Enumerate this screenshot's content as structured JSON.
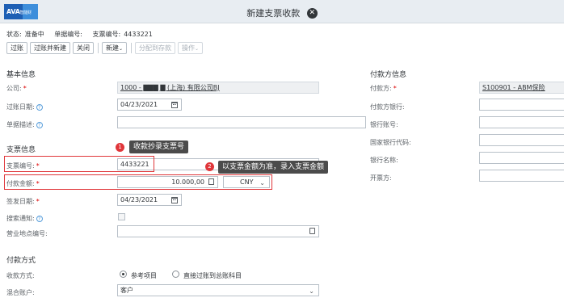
{
  "header": {
    "logo_text": "AVA",
    "logo_sub": "智能财",
    "title": "新建支票收款"
  },
  "status": {
    "status_label": "状态:",
    "status_value": "准备中",
    "doc_no_label": "单据编号:",
    "cheque_no_label": "支票编号:",
    "cheque_no_value": "4433221"
  },
  "toolbar": {
    "post": "过账",
    "post_new": "过账并新建",
    "close": "关闭",
    "new": "新建",
    "allocate": "分配到存款",
    "actions": "操作"
  },
  "basic": {
    "title": "基本信息",
    "company_label": "公司:",
    "company_value": "1000 - ▇▇▇ ▇ (上海) 有限公司BJ",
    "posting_date_label": "过账日期:",
    "posting_date_value": "04/23/2021",
    "description_label": "单据描述:"
  },
  "cheque": {
    "title": "支票信息",
    "cheque_no_label": "支票编号:",
    "cheque_no_value": "4433221",
    "amount_label": "付款金额:",
    "amount_value": "10.000,00",
    "currency_value": "CNY",
    "issue_date_label": "签发日期:",
    "issue_date_value": "04/23/2021",
    "deposit_notice_label": "搜索通知:",
    "location_label": "营业地点编号:"
  },
  "payer": {
    "title": "付款方信息",
    "payer_label": "付款方:",
    "payer_value": "S100901 - ABM保险",
    "bank_label": "付款方银行:",
    "account_label": "银行账号:",
    "country_bank_label": "国家银行代码:",
    "bank_name_label": "银行名称:",
    "issuer_label": "开票方:"
  },
  "payment": {
    "title": "付款方式",
    "method_label": "收款方式:",
    "option_ref": "参考项目",
    "option_gl": "直接过账到总账科目",
    "mixed_label": "混合账户:",
    "mixed_value": "客户"
  },
  "annotations": {
    "note1_num": "1",
    "note1": "收款抄录支票号",
    "note2_num": "2",
    "note2": "以支票金额为准，录入支票金额"
  },
  "colors": {
    "highlight": "#e0363a",
    "header_bg": "#e8edf2",
    "callout_bg": "#4b4b4b"
  }
}
